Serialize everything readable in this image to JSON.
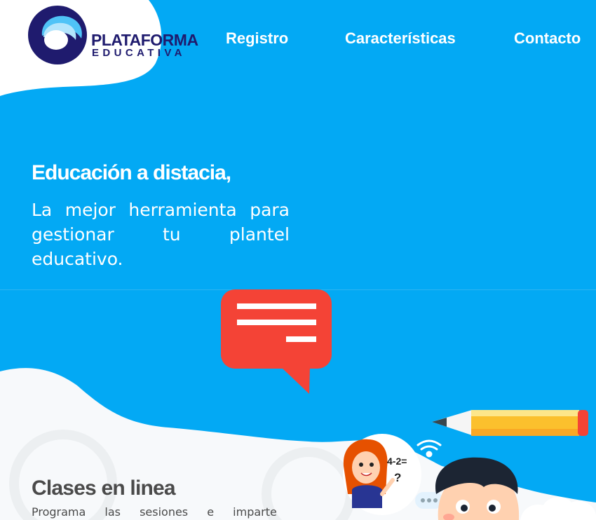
{
  "brand": {
    "name": "PLATAFORMA",
    "subtitle": "EDUCATIVA"
  },
  "nav": {
    "items": [
      {
        "label": "Registro"
      },
      {
        "label": "Características"
      },
      {
        "label": "Contacto"
      }
    ]
  },
  "hero": {
    "heading": "Educación a distacia,",
    "text": "La mejor herramienta para gestionar tu plantel educativo."
  },
  "feature": {
    "title": "Clases en linea",
    "text": "Programa las sesiones e imparte"
  },
  "illustration": {
    "math_expression": "4-2=",
    "question_mark": "?"
  },
  "colors": {
    "background": "#03a9f4",
    "brand_navy": "#1f1b6e",
    "chat_bubble": "#f44336",
    "pencil": "#fbc02d",
    "wave": "#f7f9fb"
  }
}
